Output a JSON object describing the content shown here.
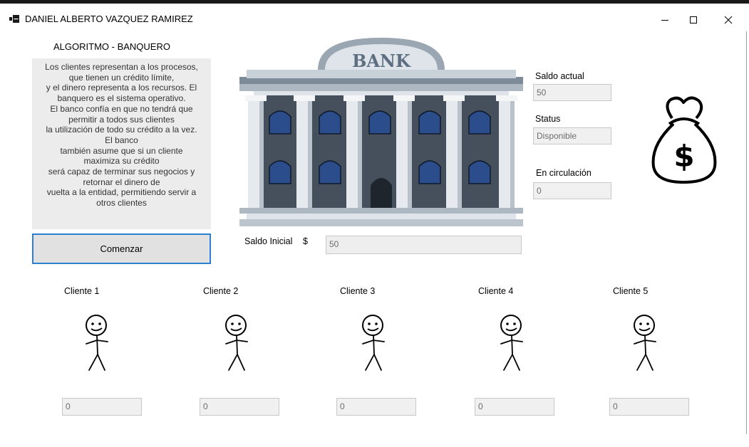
{
  "window": {
    "title": "DANIEL ALBERTO VAZQUEZ RAMIREZ",
    "icon": "app-window-icon",
    "controls": [
      "minimize-icon",
      "maximize-icon",
      "close-icon"
    ]
  },
  "algorithm": {
    "title": "ALGORITMO - BANQUERO",
    "description_lines": [
      "Los clientes representan a los procesos,",
      "que tienen un crédito límite,",
      "y el dinero representa a los recursos. El",
      "banquero es el sistema operativo.",
      "El banco confía en que no tendrá que",
      "permitir a todos sus clientes",
      "la utilización de todo su crédito a la vez.",
      "El banco",
      "también asume que si un cliente",
      "maximiza su crédito",
      "será capaz de terminar sus negocios y",
      "retornar el dinero de",
      "vuelta a la entidad, permitiendo servir a",
      "otros clientes"
    ],
    "start_button": "Comenzar"
  },
  "bank": {
    "sign": "BANK",
    "initial_balance_label": "Saldo Inicial",
    "currency_symbol": "$",
    "initial_balance_value": "50"
  },
  "status_panel": {
    "current_balance_label": "Saldo actual",
    "current_balance_value": "50",
    "status_label": "Status",
    "status_value": "Disponible",
    "circulation_label": "En circulación",
    "circulation_value": "0"
  },
  "money_bag": {
    "icon": "money-bag-icon",
    "symbol": "$"
  },
  "clients": [
    {
      "label": "Cliente 1",
      "value": "0"
    },
    {
      "label": "Cliente 2",
      "value": "0"
    },
    {
      "label": "Cliente 3",
      "value": "0"
    },
    {
      "label": "Cliente 4",
      "value": "0"
    },
    {
      "label": "Cliente 5",
      "value": "0"
    }
  ]
}
